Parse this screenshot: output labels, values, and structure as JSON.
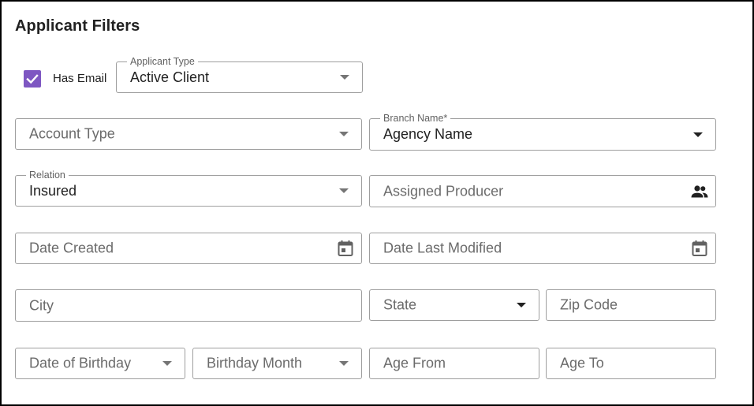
{
  "title": "Applicant Filters",
  "has_email": {
    "label": "Has Email",
    "checked": true
  },
  "applicant_type": {
    "label": "Applicant Type",
    "value": "Active Client"
  },
  "account_type": {
    "placeholder": "Account Type"
  },
  "branch_name": {
    "label": "Branch Name*",
    "value": "Agency Name"
  },
  "relation": {
    "label": "Relation",
    "value": "Insured"
  },
  "assigned_producer": {
    "placeholder": "Assigned Producer",
    "icon": "people-icon"
  },
  "date_created": {
    "placeholder": "Date Created",
    "icon": "calendar-icon"
  },
  "date_last_modified": {
    "placeholder": "Date Last Modified",
    "icon": "calendar-icon"
  },
  "city": {
    "placeholder": "City"
  },
  "state": {
    "placeholder": "State"
  },
  "zip_code": {
    "placeholder": "Zip Code"
  },
  "date_of_birthday": {
    "placeholder": "Date of Birthday"
  },
  "birthday_month": {
    "placeholder": "Birthday Month"
  },
  "age_from": {
    "placeholder": "Age From"
  },
  "age_to": {
    "placeholder": "Age To"
  },
  "colors": {
    "checkbox_accent": "#7e57c2",
    "border": "#9e9e9e",
    "placeholder_text": "#6b6b6b"
  }
}
